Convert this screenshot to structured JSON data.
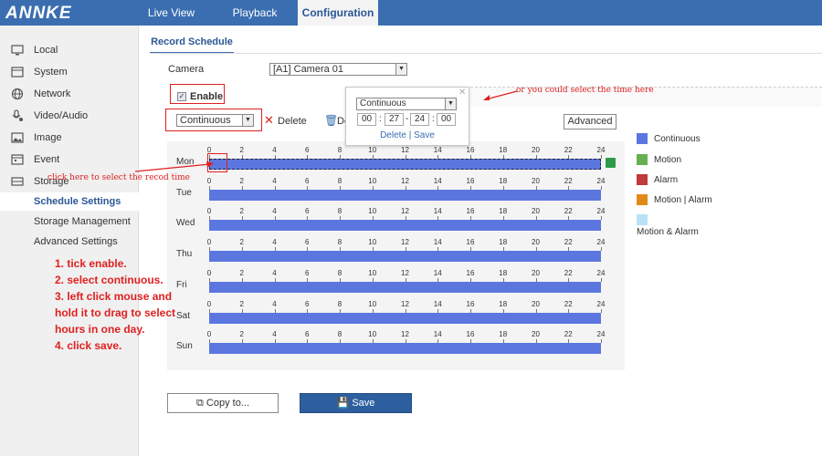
{
  "brand": {
    "logo": "ANNKE"
  },
  "nav": {
    "tabs": [
      "Live View",
      "Playback",
      "Configuration"
    ]
  },
  "sidebar": {
    "items": [
      {
        "label": "Local",
        "icon": "monitor-icon"
      },
      {
        "label": "System",
        "icon": "system-icon"
      },
      {
        "label": "Network",
        "icon": "globe-icon"
      },
      {
        "label": "Video/Audio",
        "icon": "microphone-icon"
      },
      {
        "label": "Image",
        "icon": "image-icon"
      },
      {
        "label": "Event",
        "icon": "calendar-icon"
      },
      {
        "label": "Storage",
        "icon": "storage-icon"
      }
    ],
    "subitems": [
      "Schedule Settings",
      "Storage Management",
      "Advanced Settings"
    ]
  },
  "main": {
    "tab": "Record Schedule",
    "camera_label": "Camera",
    "camera_value": "[A1] Camera 01",
    "enable_label": "Enable",
    "mode_value": "Continuous",
    "delete_label": "Delete",
    "delete_all_label": "De",
    "advanced_label": "Advanced",
    "copy_label": "Copy to...",
    "save_label": "Save"
  },
  "schedule": {
    "days": [
      "Mon",
      "Tue",
      "Wed",
      "Thu",
      "Fri",
      "Sat",
      "Sun"
    ],
    "hours": [
      "0",
      "2",
      "4",
      "6",
      "8",
      "10",
      "12",
      "14",
      "16",
      "18",
      "20",
      "22",
      "24"
    ],
    "coverage": "00:00-24:00"
  },
  "popup": {
    "mode": "Continuous",
    "start_h": "00",
    "start_m": "27",
    "end_h": "24",
    "end_m": "00",
    "delete": "Delete",
    "save": "Save",
    "sep": "|"
  },
  "legend": [
    {
      "label": "Continuous",
      "color": "#5b77df"
    },
    {
      "label": "Motion",
      "color": "#66b04f"
    },
    {
      "label": "Alarm",
      "color": "#c0393b"
    },
    {
      "label": "Motion | Alarm",
      "color": "#e18a1a"
    },
    {
      "label": "Motion & Alarm",
      "color": "#b9e2f7"
    }
  ],
  "annotations": {
    "select_time": "or you could select the time here",
    "click_here": "click here to select the recod time",
    "steps": [
      "1. tick enable.",
      "2. select continuous.",
      "3. left click mouse and",
      "hold it to drag to select",
      "hours in one day.",
      "4. click save."
    ]
  }
}
